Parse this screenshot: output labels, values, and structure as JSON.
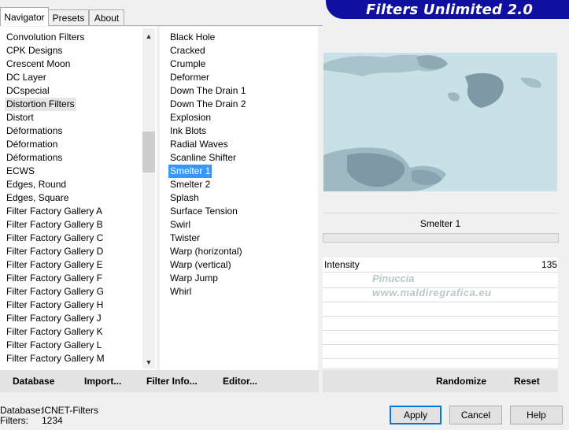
{
  "tabs": [
    "Navigator",
    "Presets",
    "About"
  ],
  "banner_title": "Filters Unlimited 2.0",
  "categories": [
    "Convolution Filters",
    "CPK Designs",
    "Crescent Moon",
    "DC Layer",
    "DCspecial",
    "Distortion Filters",
    "Distort",
    "Déformations",
    "Déformation",
    "Déformations",
    "ECWS",
    "Edges, Round",
    "Edges, Square",
    "Filter Factory Gallery A",
    "Filter Factory Gallery B",
    "Filter Factory Gallery C",
    "Filter Factory Gallery D",
    "Filter Factory Gallery E",
    "Filter Factory Gallery F",
    "Filter Factory Gallery G",
    "Filter Factory Gallery H",
    "Filter Factory Gallery J",
    "Filter Factory Gallery K",
    "Filter Factory Gallery L",
    "Filter Factory Gallery M"
  ],
  "selected_category": "Distortion Filters",
  "filters": [
    "Black Hole",
    "Cracked",
    "Crumple",
    "Deformer",
    "Down The Drain 1",
    "Down The Drain 2",
    "Explosion",
    "Ink Blots",
    "Radial Waves",
    "Scanline Shifter",
    "Smelter 1",
    "Smelter 2",
    "Splash",
    "Surface Tension",
    "Swirl",
    "Twister",
    "Warp (horizontal)",
    "Warp (vertical)",
    "Warp Jump",
    "Whirl"
  ],
  "selected_filter": "Smelter 1",
  "filter_name": "Smelter 1",
  "param": {
    "label": "Intensity",
    "value": "135"
  },
  "watermark": {
    "line1": "Pinuccia",
    "line2": "www.maldiregrafica.eu"
  },
  "toolbar": {
    "database": "Database",
    "import": "Import...",
    "filter_info": "Filter Info...",
    "editor": "Editor...",
    "randomize": "Randomize",
    "reset": "Reset"
  },
  "db": {
    "database_label": "Database:",
    "database_value": "ICNET-Filters",
    "filters_label": "Filters:",
    "filters_value": "1234"
  },
  "buttons": {
    "apply": "Apply",
    "cancel": "Cancel",
    "help": "Help"
  },
  "colors": {
    "banner": "#1010a0",
    "selection": "#3399ff",
    "preview_bg": "#c7e1e6"
  }
}
